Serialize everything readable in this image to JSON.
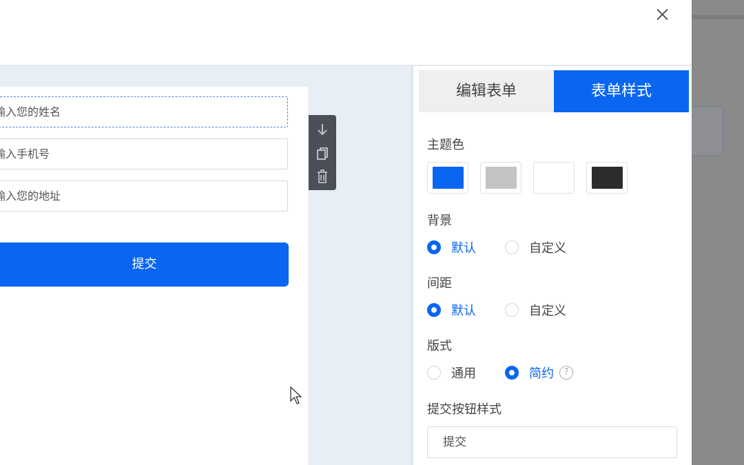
{
  "form": {
    "fields": [
      {
        "value": "输入您的姓名"
      },
      {
        "value": "输入手机号"
      },
      {
        "value": "输入您的地址"
      }
    ],
    "submit_label": "提交"
  },
  "toolbar": {
    "icons": [
      "arrow-down-icon",
      "copy-icon",
      "trash-icon"
    ]
  },
  "panel": {
    "tabs": [
      {
        "label": "编辑表单",
        "active": false
      },
      {
        "label": "表单样式",
        "active": true
      }
    ],
    "theme_color": {
      "label": "主题色",
      "swatches": [
        "#0a66f0",
        "#c4c4c4",
        "#ffffff",
        "#2c2c2c"
      ]
    },
    "background": {
      "label": "背景",
      "options": [
        {
          "label": "默认",
          "checked": true
        },
        {
          "label": "自定义",
          "checked": false
        }
      ]
    },
    "spacing": {
      "label": "间距",
      "options": [
        {
          "label": "默认",
          "checked": true
        },
        {
          "label": "自定义",
          "checked": false
        }
      ]
    },
    "layout": {
      "label": "版式",
      "options": [
        {
          "label": "通用",
          "checked": false
        },
        {
          "label": "简约",
          "checked": true
        }
      ],
      "help_icon": "?"
    },
    "submit_style": {
      "label": "提交按钮样式",
      "value": "提交"
    }
  },
  "colors": {
    "accent": "#0a66f0",
    "canvas_bg": "#e8eef6",
    "toolbar_bg": "#4b4f57"
  }
}
